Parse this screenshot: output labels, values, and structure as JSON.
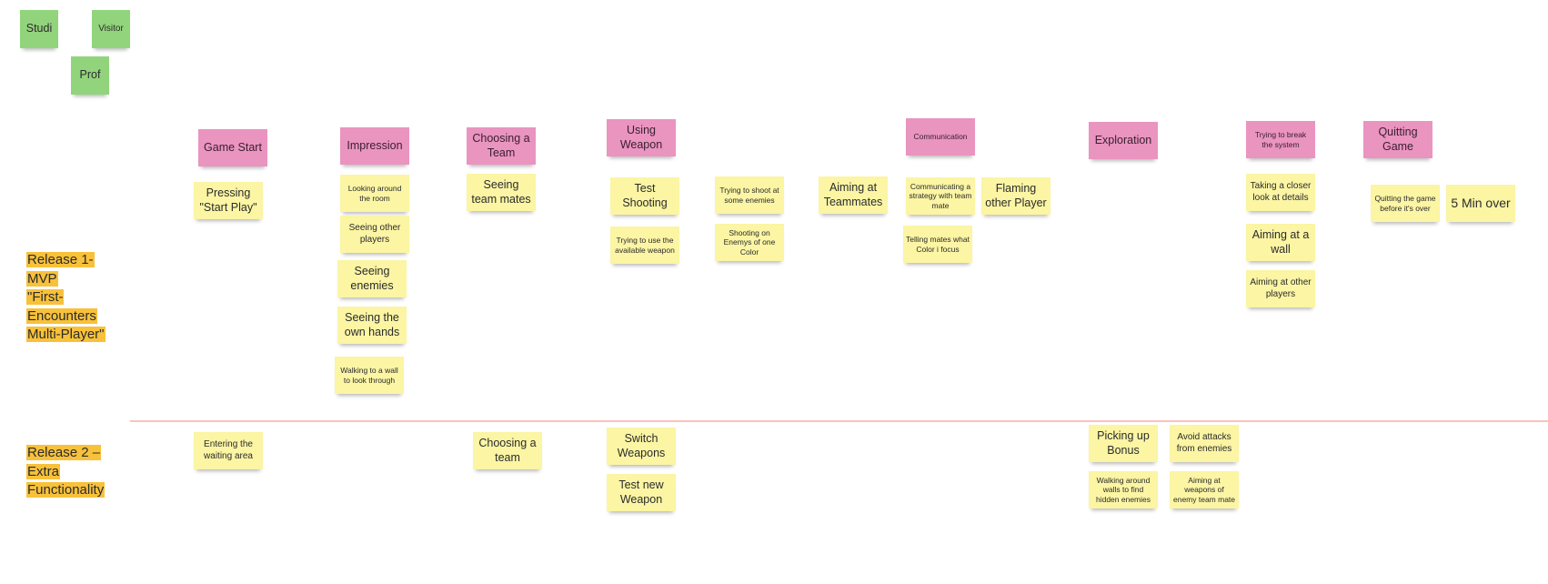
{
  "personas": [
    {
      "label": "Studi"
    },
    {
      "label": "Visitor"
    },
    {
      "label": "Prof"
    }
  ],
  "releases": [
    {
      "lines": [
        "Release 1-",
        "MVP",
        "\"First-",
        "Encounters",
        "Multi-Player\""
      ]
    },
    {
      "lines": [
        "Release 2 –",
        "Extra",
        "Functionality"
      ]
    }
  ],
  "activities": [
    {
      "label": "Game Start"
    },
    {
      "label": "Impression"
    },
    {
      "label": "Choosing a Team"
    },
    {
      "label": "Using Weapon"
    },
    {
      "label": "Communication"
    },
    {
      "label": "Exploration"
    },
    {
      "label": "Trying to break the system"
    },
    {
      "label": "Quitting Game"
    }
  ],
  "release1_tasks": {
    "game_start": [
      "Pressing \"Start Play\""
    ],
    "impression": [
      "Looking around the room",
      "Seeing other players",
      "Seeing enemies",
      "Seeing the own hands",
      "Walking to a wall to look through"
    ],
    "choosing_team": [
      "Seeing team mates"
    ],
    "using_weapon": [
      "Test Shooting",
      "Trying to use the available weapon",
      "Trying to shoot at some enemies",
      "Shooting on Enemys of one Color",
      "Aiming at Teammates"
    ],
    "communication": [
      "Communicating a strategy with team mate",
      "Telling mates what Color i focus",
      "Flaming other Player"
    ],
    "break_system": [
      "Taking a closer look at details",
      "Aiming at a wall",
      "Aiming at other players"
    ],
    "quitting": [
      "Quitting the game before it's over",
      "5 Min over"
    ]
  },
  "release2_tasks": {
    "game_start": [
      "Entering the waiting area"
    ],
    "choosing_team": [
      "Choosing a team"
    ],
    "using_weapon": [
      "Switch Weapons",
      "Test new Weapon"
    ],
    "exploration": [
      "Picking up Bonus",
      "Walking around walls to find hidden enemies",
      "Avoid attacks from enemies",
      "Aiming at weapons of enemy team mate"
    ]
  },
  "colors": {
    "persona": "#92d47c",
    "activity": "#ea94c0",
    "task": "#fbf5a4",
    "release_label": "#f8c13a",
    "release_divider": "#f7c4bb"
  }
}
